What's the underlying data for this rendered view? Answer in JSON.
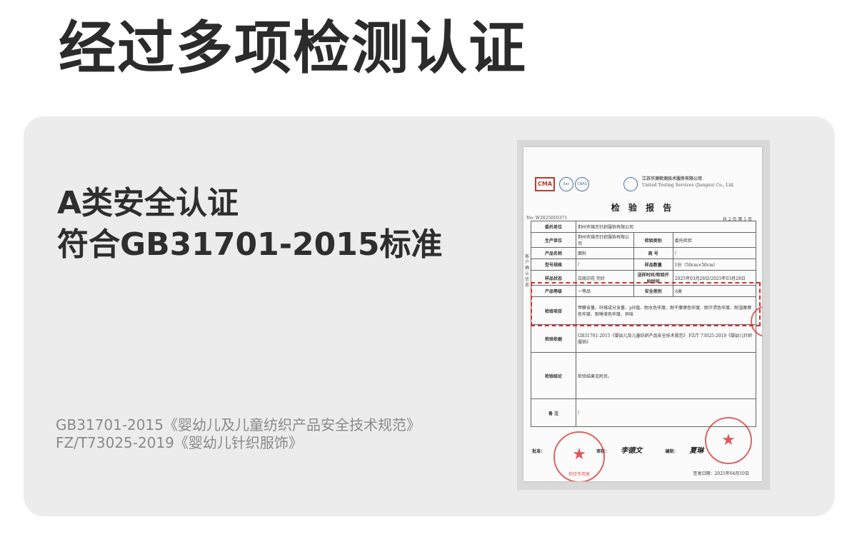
{
  "header": {
    "title": "经过多项检测认证"
  },
  "certification": {
    "line1": "A类安全认证",
    "line2": "符合GB31701-2015标准"
  },
  "standards": {
    "line1": "GB31701-2015《婴幼儿及儿童纺织产品安全技术规范》",
    "line2": "FZ/T73025-2019《婴幼儿针织服饰》"
  },
  "report": {
    "logo_cma": "CMA",
    "logo_a": "ilac",
    "logo_b": "CNAS",
    "lab_name_cn": "江苏华测检测技术服务有限公司",
    "lab_name_en": "United Testing Services (Jiangsu) Co., Ltd.",
    "title": "检 验 报 告",
    "report_no": "No: W2025010371",
    "page": "共 2 页  第 1 页",
    "side_note": "客户确认信息",
    "rows": {
      "client_label": "委托单位",
      "client_value": "荆州市锦杰针织服饰有限公司",
      "producer_label": "生产单位",
      "producer_value": "荆州市锦杰针织服饰有限公司",
      "test_type_label": "检验类别",
      "test_type_value": "委托检验",
      "product_label": "产品名称",
      "product_value": "面料",
      "trademark_label": "商   号",
      "trademark_value": "/",
      "model_label": "型号规格",
      "model_value": "/",
      "sample_qty_label": "样品数量",
      "sample_qty_value": "1份（50cm×50cm）",
      "state_label": "样品状态",
      "state_value": "白底印花 完好",
      "dates_label": "送样时间/检验开始时间",
      "dates_value": "2025年03月28日/2025年03月28日",
      "grade_label": "产品等级",
      "grade_value": "一等品",
      "safety_label": "安全类别",
      "safety_value": "A类",
      "items_label": "检验项目",
      "items_value": "甲醛含量、纤维成分含量、pH值、耐水色牢度、耐干摩擦色牢度、耐汗渍色牢度、耐湿摩擦色牢度、耐唾液色牢度、异味",
      "basis_label": "检验依据",
      "basis_value": "GB31701-2015《婴幼儿及儿童纺织产品安全技术规范》 FZ/T 73025-2019《婴幼儿针织服饰》",
      "conclusion_label": "检验结论",
      "conclusion_value": "检验结果见附页。",
      "remarks_label": "备   注",
      "remarks_value": "/"
    },
    "sign": {
      "approve_label": "批准：",
      "review_label": "审核：",
      "edit_label": "编制：",
      "reviewer_sig": "李德文",
      "editor_sig": "夏琳"
    },
    "issue_date": "签发日期：2025年04月10日",
    "stamp_text": "检验专用章"
  },
  "colors": {
    "heading": "#2b2b2b",
    "panel": "#ececec",
    "standards_text": "#8a8a8a",
    "highlight": "#d63031"
  }
}
